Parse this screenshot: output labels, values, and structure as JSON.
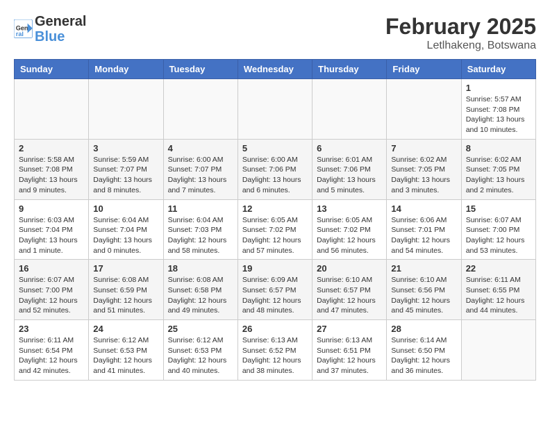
{
  "header": {
    "logo_line1": "General",
    "logo_line2": "Blue",
    "month_year": "February 2025",
    "location": "Letlhakeng, Botswana"
  },
  "weekdays": [
    "Sunday",
    "Monday",
    "Tuesday",
    "Wednesday",
    "Thursday",
    "Friday",
    "Saturday"
  ],
  "weeks": [
    [
      {
        "day": "",
        "info": ""
      },
      {
        "day": "",
        "info": ""
      },
      {
        "day": "",
        "info": ""
      },
      {
        "day": "",
        "info": ""
      },
      {
        "day": "",
        "info": ""
      },
      {
        "day": "",
        "info": ""
      },
      {
        "day": "1",
        "info": "Sunrise: 5:57 AM\nSunset: 7:08 PM\nDaylight: 13 hours\nand 10 minutes."
      }
    ],
    [
      {
        "day": "2",
        "info": "Sunrise: 5:58 AM\nSunset: 7:08 PM\nDaylight: 13 hours\nand 9 minutes."
      },
      {
        "day": "3",
        "info": "Sunrise: 5:59 AM\nSunset: 7:07 PM\nDaylight: 13 hours\nand 8 minutes."
      },
      {
        "day": "4",
        "info": "Sunrise: 6:00 AM\nSunset: 7:07 PM\nDaylight: 13 hours\nand 7 minutes."
      },
      {
        "day": "5",
        "info": "Sunrise: 6:00 AM\nSunset: 7:06 PM\nDaylight: 13 hours\nand 6 minutes."
      },
      {
        "day": "6",
        "info": "Sunrise: 6:01 AM\nSunset: 7:06 PM\nDaylight: 13 hours\nand 5 minutes."
      },
      {
        "day": "7",
        "info": "Sunrise: 6:02 AM\nSunset: 7:05 PM\nDaylight: 13 hours\nand 3 minutes."
      },
      {
        "day": "8",
        "info": "Sunrise: 6:02 AM\nSunset: 7:05 PM\nDaylight: 13 hours\nand 2 minutes."
      }
    ],
    [
      {
        "day": "9",
        "info": "Sunrise: 6:03 AM\nSunset: 7:04 PM\nDaylight: 13 hours\nand 1 minute."
      },
      {
        "day": "10",
        "info": "Sunrise: 6:04 AM\nSunset: 7:04 PM\nDaylight: 13 hours\nand 0 minutes."
      },
      {
        "day": "11",
        "info": "Sunrise: 6:04 AM\nSunset: 7:03 PM\nDaylight: 12 hours\nand 58 minutes."
      },
      {
        "day": "12",
        "info": "Sunrise: 6:05 AM\nSunset: 7:02 PM\nDaylight: 12 hours\nand 57 minutes."
      },
      {
        "day": "13",
        "info": "Sunrise: 6:05 AM\nSunset: 7:02 PM\nDaylight: 12 hours\nand 56 minutes."
      },
      {
        "day": "14",
        "info": "Sunrise: 6:06 AM\nSunset: 7:01 PM\nDaylight: 12 hours\nand 54 minutes."
      },
      {
        "day": "15",
        "info": "Sunrise: 6:07 AM\nSunset: 7:00 PM\nDaylight: 12 hours\nand 53 minutes."
      }
    ],
    [
      {
        "day": "16",
        "info": "Sunrise: 6:07 AM\nSunset: 7:00 PM\nDaylight: 12 hours\nand 52 minutes."
      },
      {
        "day": "17",
        "info": "Sunrise: 6:08 AM\nSunset: 6:59 PM\nDaylight: 12 hours\nand 51 minutes."
      },
      {
        "day": "18",
        "info": "Sunrise: 6:08 AM\nSunset: 6:58 PM\nDaylight: 12 hours\nand 49 minutes."
      },
      {
        "day": "19",
        "info": "Sunrise: 6:09 AM\nSunset: 6:57 PM\nDaylight: 12 hours\nand 48 minutes."
      },
      {
        "day": "20",
        "info": "Sunrise: 6:10 AM\nSunset: 6:57 PM\nDaylight: 12 hours\nand 47 minutes."
      },
      {
        "day": "21",
        "info": "Sunrise: 6:10 AM\nSunset: 6:56 PM\nDaylight: 12 hours\nand 45 minutes."
      },
      {
        "day": "22",
        "info": "Sunrise: 6:11 AM\nSunset: 6:55 PM\nDaylight: 12 hours\nand 44 minutes."
      }
    ],
    [
      {
        "day": "23",
        "info": "Sunrise: 6:11 AM\nSunset: 6:54 PM\nDaylight: 12 hours\nand 42 minutes."
      },
      {
        "day": "24",
        "info": "Sunrise: 6:12 AM\nSunset: 6:53 PM\nDaylight: 12 hours\nand 41 minutes."
      },
      {
        "day": "25",
        "info": "Sunrise: 6:12 AM\nSunset: 6:53 PM\nDaylight: 12 hours\nand 40 minutes."
      },
      {
        "day": "26",
        "info": "Sunrise: 6:13 AM\nSunset: 6:52 PM\nDaylight: 12 hours\nand 38 minutes."
      },
      {
        "day": "27",
        "info": "Sunrise: 6:13 AM\nSunset: 6:51 PM\nDaylight: 12 hours\nand 37 minutes."
      },
      {
        "day": "28",
        "info": "Sunrise: 6:14 AM\nSunset: 6:50 PM\nDaylight: 12 hours\nand 36 minutes."
      },
      {
        "day": "",
        "info": ""
      }
    ]
  ]
}
